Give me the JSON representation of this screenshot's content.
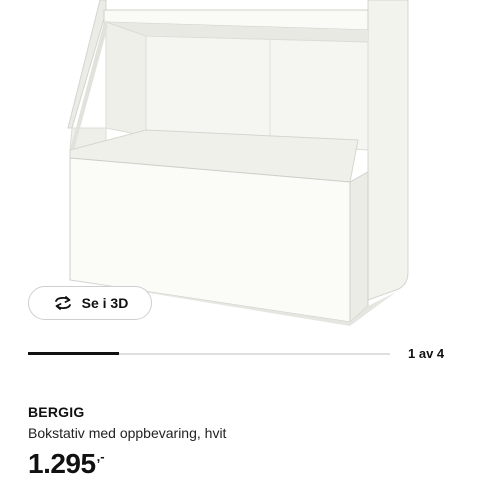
{
  "gallery": {
    "image_alt": "BERGIG",
    "view_3d_label": "Se i 3D",
    "view_3d_icon": "rotate-3d-icon",
    "counter": "1 av 4",
    "progress_fraction": 0.25
  },
  "product": {
    "name": "BERGIG",
    "description": "Bokstativ med oppbevaring, hvit",
    "price_main": "1.295",
    "price_suffix": ",-"
  }
}
